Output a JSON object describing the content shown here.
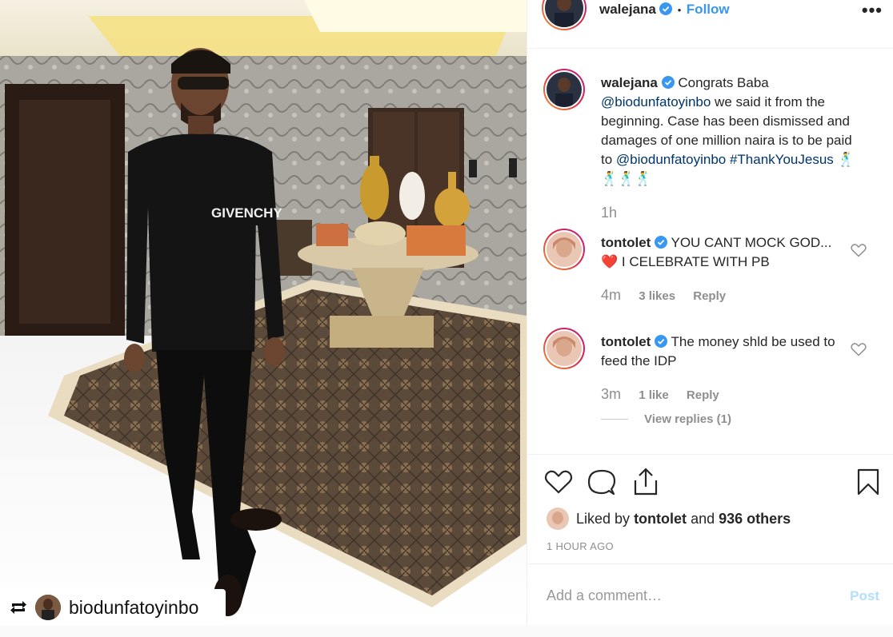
{
  "post": {
    "author": "walejana",
    "follow_separator": "•",
    "follow_label": "Follow",
    "more_label": "•••"
  },
  "repost": {
    "username": "biodunfatoyinbo"
  },
  "caption": {
    "author": "walejana",
    "text_1": "Congrats Baba",
    "mention_1": "@biodunfatoyinbo",
    "text_2": "we said it from the beginning. Case has been dismissed and damages of one million naira is to be paid to",
    "mention_2": "@biodunfatoyinbo",
    "hashtag": "#ThankYouJesus",
    "emoji": "🕺🕺🕺🕺",
    "time": "1h"
  },
  "comments": [
    {
      "author": "tontolet",
      "text_1": "YOU CANT MOCK GOD...",
      "emoji": "❤️",
      "text_2": "I CELEBRATE WITH PB",
      "time": "4m",
      "likes": "3 likes",
      "reply": "Reply"
    },
    {
      "author": "tontolet",
      "text": "The money shld be used to feed the IDP",
      "time": "3m",
      "likes": "1 like",
      "reply": "Reply",
      "view_replies": "View replies (1)"
    }
  ],
  "likes": {
    "prefix": "Liked by",
    "user": "tontolet",
    "and": "and",
    "others": "936 others"
  },
  "posted_time": "1 HOUR AGO",
  "add_comment": {
    "placeholder": "Add a comment…",
    "post_label": "Post"
  },
  "colors": {
    "link": "#3897f0",
    "mention": "#003569",
    "meta": "#8e8e8e",
    "heart_red": "#ed4956"
  }
}
